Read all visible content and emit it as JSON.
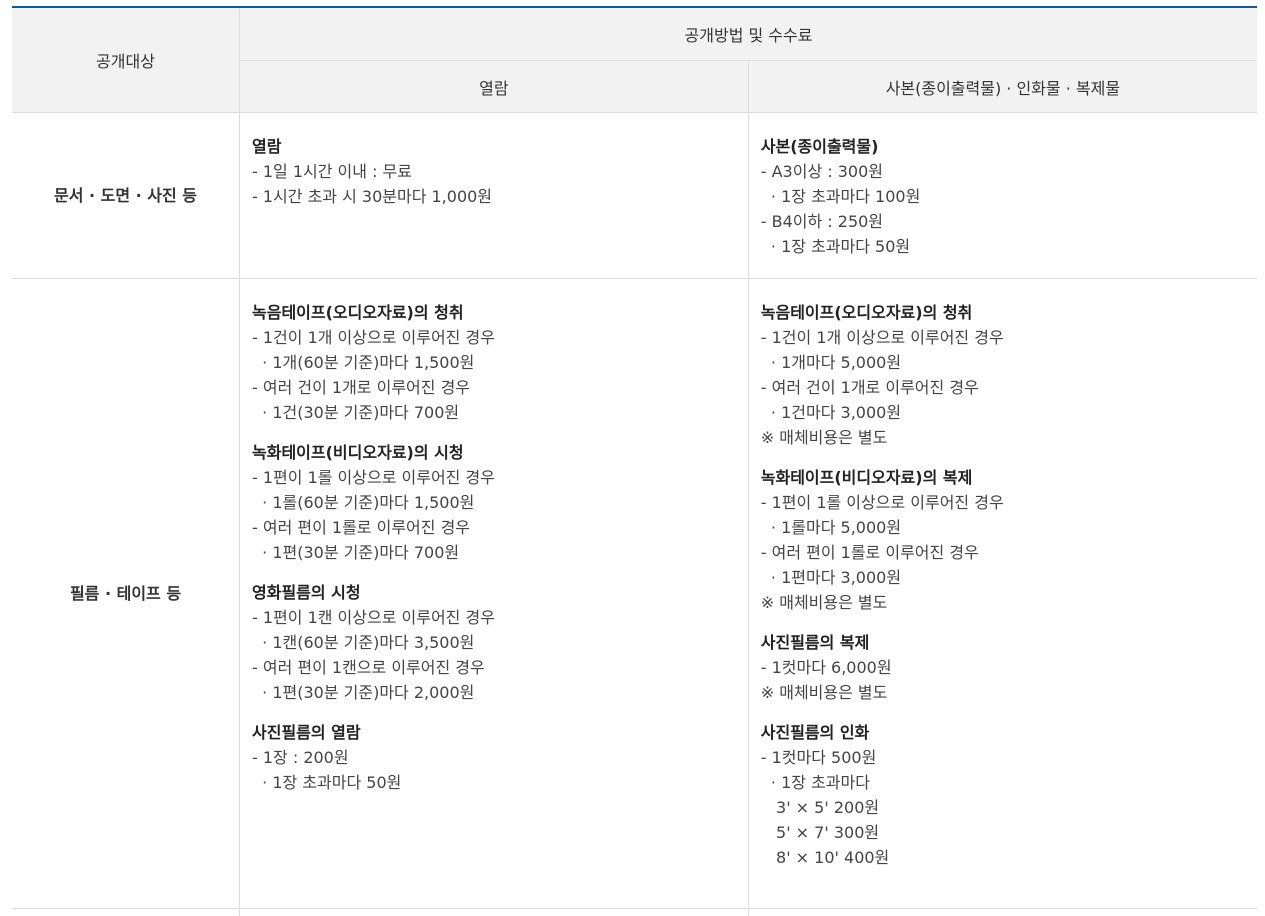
{
  "header": {
    "target": "공개대상",
    "method": "공개방법 및 수수료",
    "view": "열람",
    "copy": "사본(종이출력물) · 인화물 · 복제물"
  },
  "rows": [
    {
      "label": "문서 · 도면 · 사진 등",
      "view": [
        {
          "title": "열람",
          "lines": [
            "- 1일 1시간 이내 : 무료",
            "- 1시간 초과 시 30분마다 1,000원"
          ]
        }
      ],
      "copy": [
        {
          "title": "사본(종이출력물)",
          "lines": [
            "- A3이상 : 300원",
            "  · 1장 초과마다 100원",
            "- B4이하 : 250원",
            "  · 1장 초과마다 50원"
          ]
        }
      ]
    },
    {
      "label": "필름 · 테이프 등",
      "view": [
        {
          "title": "녹음테이프(오디오자료)의 청취",
          "lines": [
            "- 1건이 1개 이상으로 이루어진 경우",
            "  · 1개(60분 기준)마다 1,500원",
            "- 여러 건이 1개로 이루어진 경우",
            "  · 1건(30분 기준)마다 700원"
          ]
        },
        {
          "title": "녹화테이프(비디오자료)의 시청",
          "lines": [
            "- 1편이 1롤 이상으로 이루어진 경우",
            "  · 1롤(60분 기준)마다 1,500원",
            "- 여러 편이 1롤로 이루어진 경우",
            "  · 1편(30분 기준)마다 700원"
          ]
        },
        {
          "title": "영화필름의 시청",
          "lines": [
            "- 1편이 1캔 이상으로 이루어진 경우",
            "  · 1캔(60분 기준)마다 3,500원",
            "- 여러 편이 1캔으로 이루어진 경우",
            "  · 1편(30분 기준)마다 2,000원"
          ]
        },
        {
          "title": "사진필름의 열람",
          "lines": [
            "- 1장 : 200원",
            "  · 1장 초과마다 50원"
          ]
        }
      ],
      "copy": [
        {
          "title": "녹음테이프(오디오자료)의 청취",
          "lines": [
            "- 1건이 1개 이상으로 이루어진 경우",
            "  · 1개마다 5,000원",
            "- 여러 건이 1개로 이루어진 경우",
            "  · 1건마다 3,000원",
            "※ 매체비용은 별도"
          ]
        },
        {
          "title": "녹화테이프(비디오자료)의 복제",
          "lines": [
            "- 1편이 1롤 이상으로 이루어진 경우",
            "  · 1롤마다 5,000원",
            "- 여러 편이 1롤로 이루어진 경우",
            "  · 1편마다 3,000원",
            "※ 매체비용은 별도"
          ]
        },
        {
          "title": "사진필름의 복제",
          "lines": [
            "- 1컷마다 6,000원",
            "※ 매체비용은 별도"
          ]
        },
        {
          "title": "사진필름의 인화",
          "lines": [
            "- 1컷마다 500원",
            "  · 1장 초과마다",
            "   3' × 5' 200원",
            "   5' × 7' 300원",
            "   8' × 10' 400원"
          ]
        }
      ]
    }
  ]
}
